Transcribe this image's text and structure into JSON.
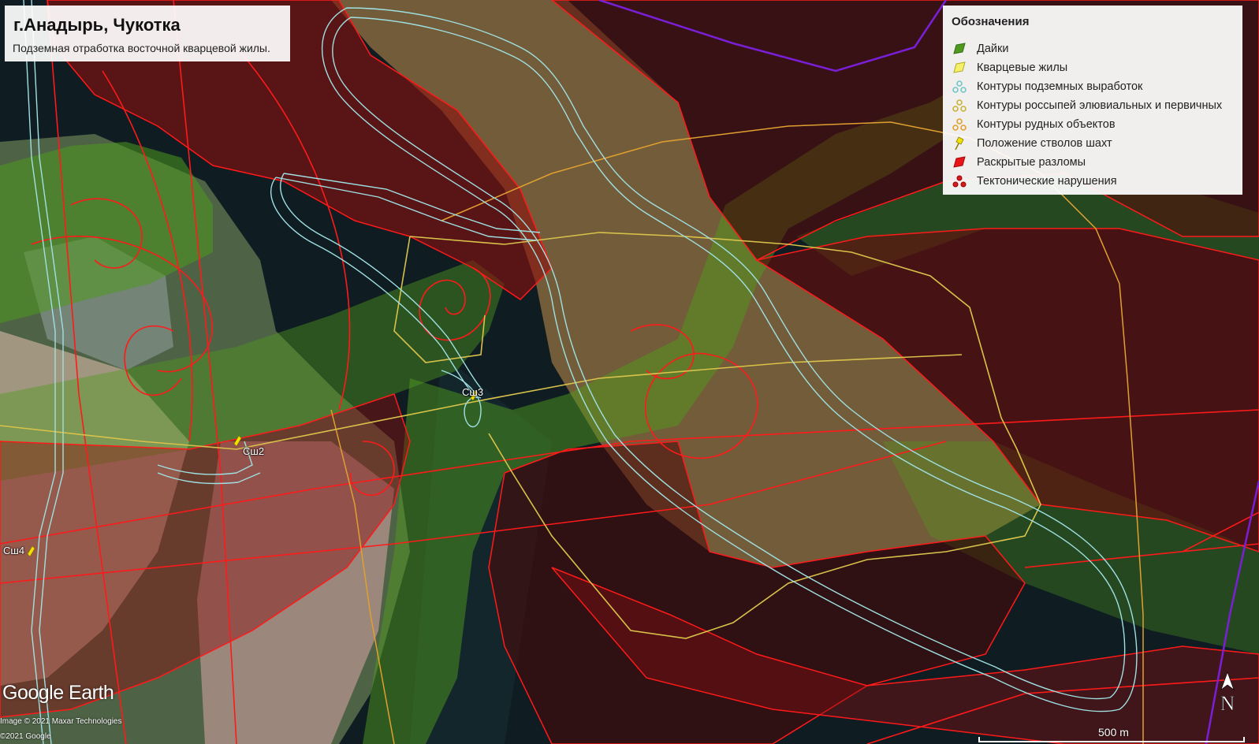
{
  "title": {
    "main": "г.Анадырь, Чукотка",
    "subtitle": "Подземная отработка восточной кварцевой жилы."
  },
  "legend": {
    "title": "Обозначения",
    "items": [
      {
        "label": "Дайки",
        "icon": "polygon-icon",
        "color": "#4f9a1e"
      },
      {
        "label": "Кварцевые жилы",
        "icon": "polygon-icon",
        "color": "#f5f06a"
      },
      {
        "label": "Контуры подземных выработок",
        "icon": "multi-point-icon",
        "color": "#7fd6d8"
      },
      {
        "label": "Контуры россыпей элювиальных и первичных",
        "icon": "multi-point-icon",
        "color": "#d8c24a"
      },
      {
        "label": "Контуры рудных объектов",
        "icon": "multi-point-icon",
        "color": "#e0a030"
      },
      {
        "label": "Положение стволов шахт",
        "icon": "pushpin-icon",
        "color": "#f2e200"
      },
      {
        "label": "Раскрытые разломы",
        "icon": "polygon-icon",
        "color": "#e8141a"
      },
      {
        "label": "Тектонические нарушения",
        "icon": "multi-point-icon",
        "color": "#d41d1d"
      }
    ]
  },
  "shafts": [
    {
      "label": "Сш2"
    },
    {
      "label": "Сш3"
    },
    {
      "label": "Сш4"
    }
  ],
  "attribution": {
    "logo": "Google Earth",
    "imagery": "Image © 2021 Maxar Technologies",
    "copyright": "©2021 Google"
  },
  "scale": {
    "label": "500 m"
  },
  "north": {
    "label": "N"
  },
  "colors": {
    "dyke_fill": "#4f9a1e",
    "vein_fill": "#a08a4a",
    "fault_fill": "#8a0f0f",
    "fault_line": "#ff1a1a",
    "workings_line": "#9fe0e2",
    "placer_line": "#d8c24a",
    "ore_line": "#e0a030",
    "boundary_line": "#7a1fd6"
  }
}
